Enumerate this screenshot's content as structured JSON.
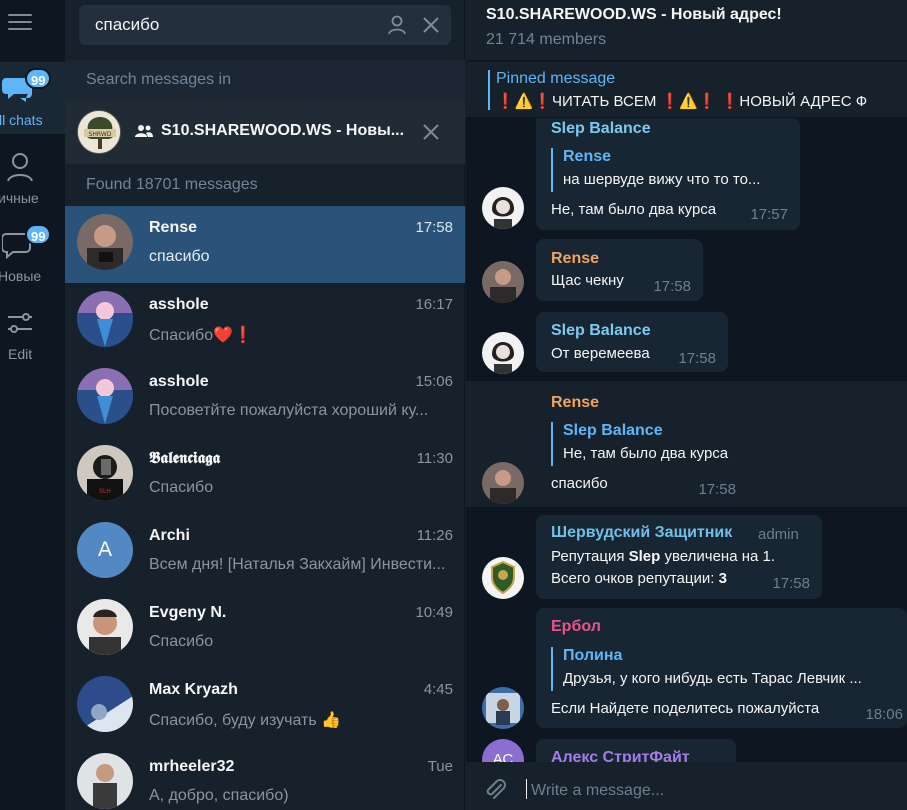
{
  "rail": {
    "all_chats": {
      "label": "ll chats",
      "badge": "99"
    },
    "personal": {
      "label": "ичные"
    },
    "new": {
      "label": "Новые",
      "badge": "99"
    },
    "edit": {
      "label": "Edit"
    }
  },
  "search": {
    "value": "спасибо"
  },
  "search_in": "Search messages in",
  "scope": {
    "name": "S10.SHAREWOOD.WS - Новы..."
  },
  "found": "Found 18701 messages",
  "results": [
    {
      "name": "Rense",
      "time": "17:58",
      "preview": "спасибо"
    },
    {
      "name": "asshole",
      "time": "16:17",
      "preview": "Спасибо❤️❗"
    },
    {
      "name": "asshole",
      "time": "15:06",
      "preview": "Посоветйте пожалуйста хороший ку..."
    },
    {
      "name": "𝕭𝖆𝖑𝖊𝖓𝖈𝖎𝖆𝖌𝖆",
      "time": "11:30",
      "preview": "Спасибо"
    },
    {
      "name": "Archi",
      "time": "11:26",
      "preview": "Всем дня! [Наталья Закхайм] Инвести...",
      "avatar_letter": "A"
    },
    {
      "name": "Evgeny N.",
      "time": "10:49",
      "preview": "Спасибо"
    },
    {
      "name": "Max Kryazh",
      "time": "4:45",
      "preview": "Спасибо, буду изучать 👍"
    },
    {
      "name": "mrheeler32",
      "time": "Tue",
      "preview": "А, добро, спасибо)"
    }
  ],
  "chat": {
    "title": "S10.SHAREWOOD.WS - Новый адрес!",
    "members": "21 714 members",
    "pinned_label": "Pinned message",
    "pinned_text": "❗⚠️❗ЧИТАТЬ ВСЕМ ❗⚠️❗ ❗НОВЫЙ АДРЕС Ф"
  },
  "messages": [
    {
      "sender": "Slep Balance",
      "quote_name": "Rense",
      "quote_text": "на шервуде вижу что то то...",
      "text": "Не, там было два курса",
      "time": "17:57"
    },
    {
      "sender": "Rense",
      "text": "Щас чекну",
      "time": "17:58"
    },
    {
      "sender": "Slep Balance",
      "text": "От веремеева",
      "time": "17:58"
    },
    {
      "sender": "Rense",
      "quote_name": "Slep Balance",
      "quote_text": "Не, там было два курса",
      "text": "спасибо",
      "time": "17:58"
    },
    {
      "sender": "Шервудский Защитник",
      "role": "admin",
      "line1_pre": "Репутация ",
      "line1_bold": "Slep",
      "line1_post": " увеличена на 1.",
      "line2_pre": "Всего очков репутации: ",
      "line2_bold": "3",
      "time": "17:58"
    },
    {
      "sender": "Ербол",
      "quote_name": "Полина",
      "quote_text": "Друзья, у кого нибудь есть Тарас Левчик ...",
      "text": "Если Найдете поделитесь пожалуйста",
      "time": "18:06"
    },
    {
      "sender": "Алекс СтритФайт",
      "avatar_letters": "АС"
    }
  ],
  "composer": {
    "placeholder": "Write a message..."
  },
  "colors": {
    "accent": "#5eb5f7",
    "selected": "#2b5278",
    "bubble": "#182533",
    "slep": "#7ec9f0",
    "rense": "#f0a35e",
    "sherwood": "#6fc0e8",
    "erbol": "#e8558a",
    "aleks": "#a57de6"
  }
}
